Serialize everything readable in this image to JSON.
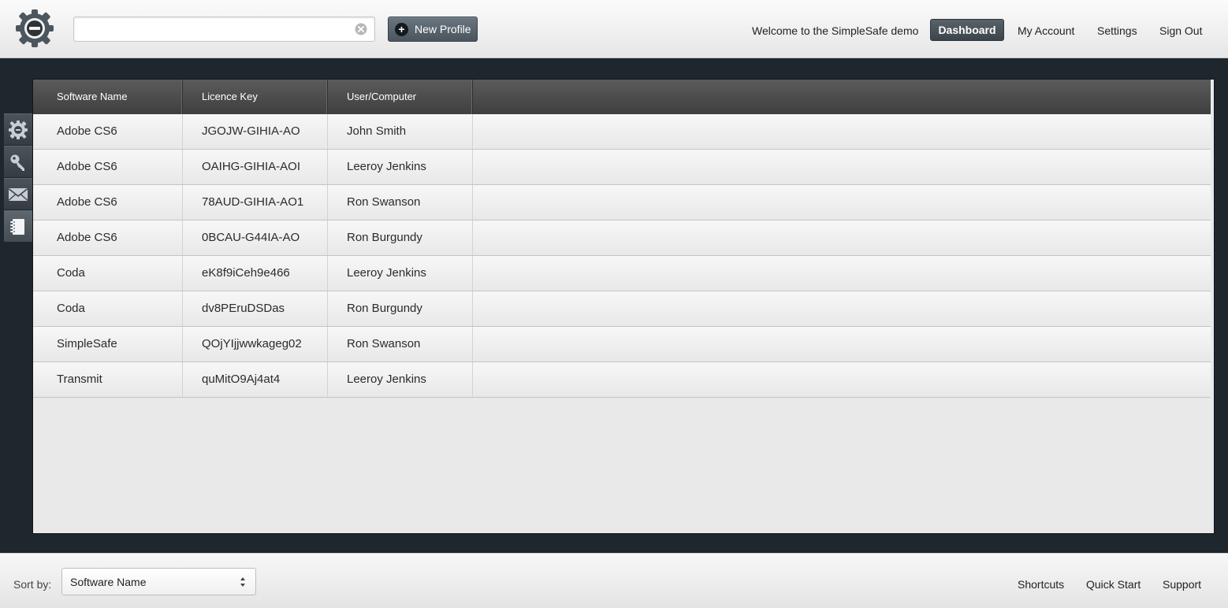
{
  "header": {
    "logo_icon": "gear-minus-icon",
    "search": {
      "value": "",
      "placeholder": "",
      "clear_icon": "clear-circle-icon"
    },
    "new_profile_label": "New Profile",
    "new_profile_icon": "plus-circle-icon",
    "welcome": "Welcome to the SimpleSafe demo",
    "nav": {
      "dashboard": "Dashboard",
      "my_account": "My Account",
      "settings": "Settings",
      "sign_out": "Sign Out"
    }
  },
  "sidebar": {
    "items": [
      {
        "icon": "gear-icon",
        "active": false
      },
      {
        "icon": "key-icon",
        "active": false
      },
      {
        "icon": "envelope-icon",
        "active": false
      },
      {
        "icon": "notebook-icon",
        "active": true
      }
    ]
  },
  "table": {
    "columns": [
      "Software Name",
      "Licence Key",
      "User/Computer",
      ""
    ],
    "rows": [
      {
        "software": "Adobe CS6",
        "key": "JGOJW-GIHIA-AO",
        "user": "John Smith"
      },
      {
        "software": "Adobe CS6",
        "key": "OAIHG-GIHIA-AOI",
        "user": "Leeroy Jenkins"
      },
      {
        "software": "Adobe CS6",
        "key": "78AUD-GIHIA-AO1",
        "user": "Ron Swanson"
      },
      {
        "software": "Adobe CS6",
        "key": "0BCAU-G44IA-AO",
        "user": "Ron Burgundy"
      },
      {
        "software": "Coda",
        "key": "eK8f9iCeh9e466",
        "user": "Leeroy Jenkins"
      },
      {
        "software": "Coda",
        "key": "dv8PEruDSDas",
        "user": "Ron Burgundy"
      },
      {
        "software": "SimpleSafe",
        "key": "QOjYIjjwwkageg02",
        "user": "Ron Swanson"
      },
      {
        "software": "Transmit",
        "key": "quMitO9Aj4at4",
        "user": "Leeroy Jenkins"
      }
    ]
  },
  "footer": {
    "sort_label": "Sort by:",
    "sort_value": "Software Name",
    "links": {
      "shortcuts": "Shortcuts",
      "quick_start": "Quick Start",
      "support": "Support"
    }
  },
  "colors": {
    "page_bg": "#1e272d",
    "accent_button": "#4a555e",
    "active_nav": "#3c444b",
    "table_header": "#4a4a4a"
  }
}
